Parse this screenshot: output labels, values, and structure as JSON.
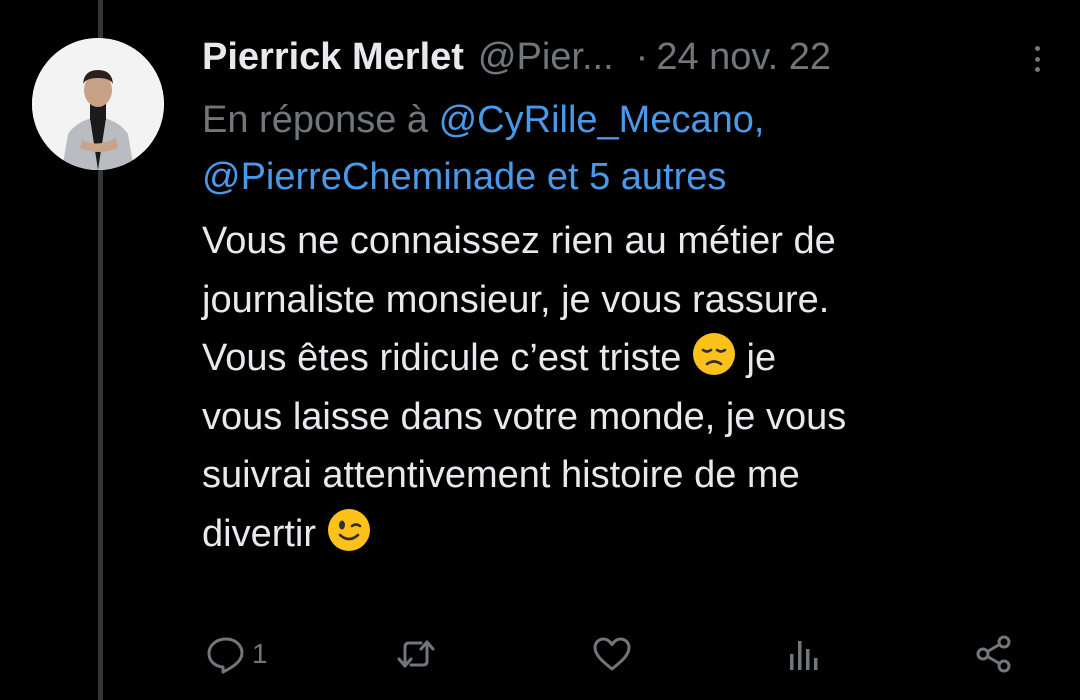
{
  "tweet": {
    "author_name": "Pierrick Merlet",
    "author_handle": "@Pier...",
    "separator": "·",
    "date": "24 nov. 22",
    "reply_prefix": "En réponse à ",
    "reply_mention_1": "@CyRille_Mecano,",
    "reply_mention_2": "@PierreCheminade et 5 autres",
    "text_lines": [
      "Vous ne connaissez rien au métier de",
      "journaliste monsieur, je vous rassure.",
      "Vous êtes ridicule  c’est triste ",
      " je",
      "vous laisse dans votre monde, je vous",
      "suivrai attentivement histoire de me",
      "divertir "
    ],
    "emojis": [
      "disappointed-face",
      "winking-face"
    ]
  },
  "actions": {
    "reply_count": "1",
    "icons": [
      "reply-icon",
      "retweet-icon",
      "like-icon",
      "views-icon",
      "share-icon"
    ]
  },
  "colors": {
    "background": "#000000",
    "text": "#e7e9ea",
    "muted": "#71767b",
    "link": "#4a99e9",
    "thread_line": "#333639"
  }
}
